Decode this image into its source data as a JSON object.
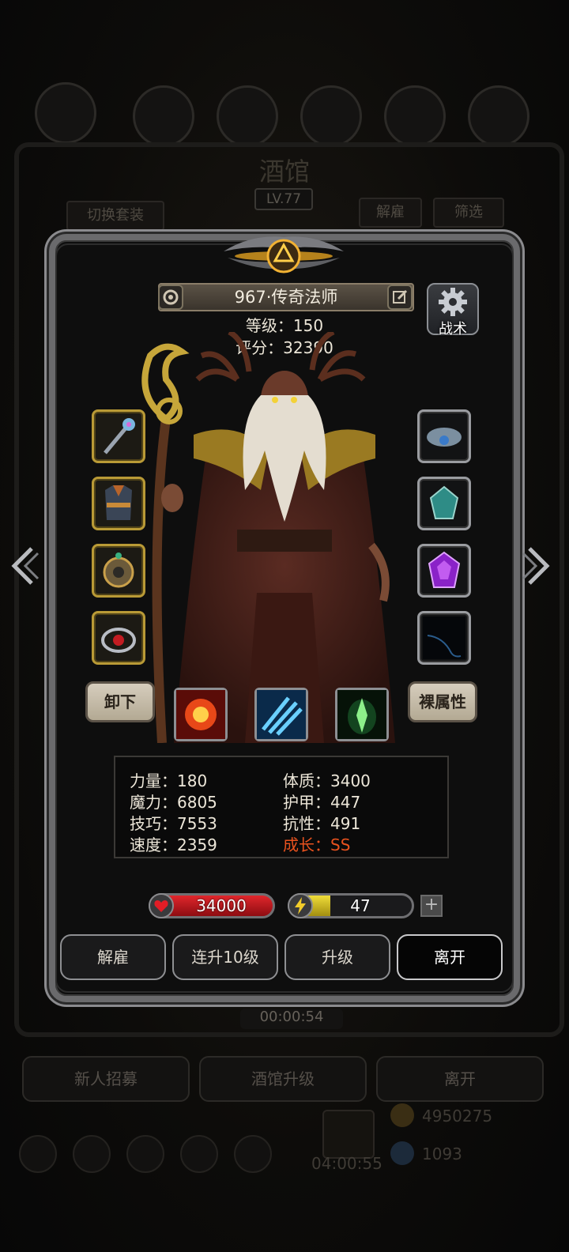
{
  "background": {
    "title": "酒馆",
    "level": "LV.77",
    "switch_outfit_label": "切换套装",
    "dismiss_tab_label": "解雇",
    "filter_tab_label": "筛选",
    "timer": "00:00:54",
    "recruit_label": "新人招募",
    "upgrade_tavern_label": "酒馆升级",
    "leave_label": "离开",
    "gold": "4950275",
    "gift_timer": "04:00:55",
    "gems": "1093"
  },
  "hero": {
    "name": "967·传奇法师",
    "level_text": "等级：150",
    "score_text": "评分：32390",
    "tactics_label": "战术"
  },
  "equipment": {
    "left": [
      "staff-item-icon",
      "armor-item-icon",
      "amulet-item-icon",
      "ring-item-icon"
    ],
    "right": [
      "crown-item-icon",
      "teal-gem-icon",
      "purple-gem-icon",
      "empty-dark-slot-icon"
    ]
  },
  "controls": {
    "unequip_label": "卸下",
    "base_attributes_label": "裸属性",
    "skills": [
      "fire-burst-skill-icon",
      "ice-shard-skill-icon",
      "green-crystal-skill-icon"
    ]
  },
  "stats": {
    "strength": "力量：180",
    "magic": "魔力：6805",
    "skill": "技巧：7553",
    "speed": "速度：2359",
    "constitution": "体质：3400",
    "armor": "护甲：447",
    "resistance": "抗性：491",
    "growth": "成长：SS"
  },
  "bars": {
    "hp": "34000",
    "energy": "47",
    "energy_fraction": 0.33
  },
  "actions": {
    "dismiss": "解雇",
    "level_up_10": "连升10级",
    "level_up": "升级",
    "leave": "离开"
  },
  "colors": {
    "hp_bar": "#c2161b",
    "energy_bar": "#c9b21c",
    "growth_text": "#e8521e",
    "gold_slot_border": "#b99a36",
    "silver_slot_border": "#9a9ca0"
  }
}
